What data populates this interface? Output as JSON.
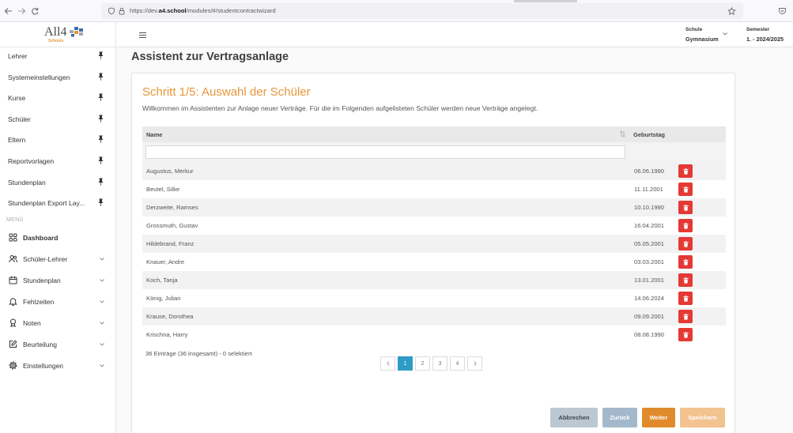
{
  "browser": {
    "url": {
      "prefix": "https://dev.",
      "host": "a4.school",
      "path": "/modules/#/studentcontractwizard"
    }
  },
  "header": {
    "logo": {
      "text": "All4",
      "subtext": "Schools"
    },
    "school": {
      "label": "Schule",
      "value": "Gymnasium"
    },
    "semester": {
      "label": "Semester",
      "value": "1. - 2024/2025"
    }
  },
  "sidebar": {
    "pinned_icon": "pin-icon",
    "pinned": [
      "Lehrer",
      "Systemeinstellungen",
      "Kurse",
      "Schüler",
      "Eltern",
      "Reportvorlagen",
      "Stundenplan",
      "Stundenplan Export Lay..."
    ],
    "menu_heading": "MENÜ",
    "menu": [
      {
        "label": "Dashboard",
        "icon": "grid-icon"
      },
      {
        "label": "Schüler-Lehrer",
        "icon": "users-icon",
        "trailing_icon": "chevron-down-icon"
      },
      {
        "label": "Stundenplan",
        "icon": "calendar-icon",
        "trailing_icon": "chevron-down-icon"
      },
      {
        "label": "Fehlzeiten",
        "icon": "bell-icon",
        "trailing_icon": "chevron-down-icon"
      },
      {
        "label": "Noten",
        "icon": "award-icon",
        "trailing_icon": "chevron-down-icon"
      },
      {
        "label": "Beurteilung",
        "icon": "edit-icon",
        "trailing_icon": "chevron-down-icon"
      },
      {
        "label": "Einstellungen",
        "icon": "gear-icon",
        "trailing_icon": "chevron-down-icon"
      }
    ]
  },
  "page": {
    "title": "Assistent zur Vertragsanlage"
  },
  "wizard": {
    "step_title": "Schritt 1/5: Auswahl der Schüler",
    "description": "Willkommen im Assistenten zur Anlage neuer Verträge. Für die im Folgenden aufgelisteten Schüler werden neue Verträge angelegt.",
    "table": {
      "columns": {
        "name": "Name",
        "birthday": "Geburtstag"
      },
      "rows": [
        {
          "name": "Augustus, Merkur",
          "birthday": "06.06.1990"
        },
        {
          "name": "Beutel, Silke",
          "birthday": "11.11.2001"
        },
        {
          "name": "Derzweite, Ramses",
          "birthday": "10.10.1990"
        },
        {
          "name": "Grossmuth, Gustav",
          "birthday": "16.04.2001"
        },
        {
          "name": "Hildebrand, Franz",
          "birthday": "05.05.2001"
        },
        {
          "name": "Knauer, Andre",
          "birthday": "03.03.2001"
        },
        {
          "name": "Koch, Tanja",
          "birthday": "13.01.2001"
        },
        {
          "name": "König, Julian",
          "birthday": "14.06.2024"
        },
        {
          "name": "Krause, Dorothea",
          "birthday": "09.09.2001"
        },
        {
          "name": "Krischna, Harry",
          "birthday": "08.08.1990"
        }
      ]
    },
    "summary": "36 Einträge (36 insgesamt) - 0 selektiert",
    "pagination": {
      "pages": [
        "1",
        "2",
        "3",
        "4"
      ],
      "current": "1"
    },
    "buttons": {
      "cancel": "Abbrechen",
      "back": "Zurück",
      "next": "Weiter",
      "save": "Speichern"
    }
  },
  "colors": {
    "accent_orange": "#e8963a",
    "active_page": "#2f9cc6",
    "delete": "#e53935",
    "cancel_button": "#bcc8d1",
    "back_button": "#a3b8ca",
    "next_button": "#e08a2c",
    "save_button": "#f2c28f"
  }
}
